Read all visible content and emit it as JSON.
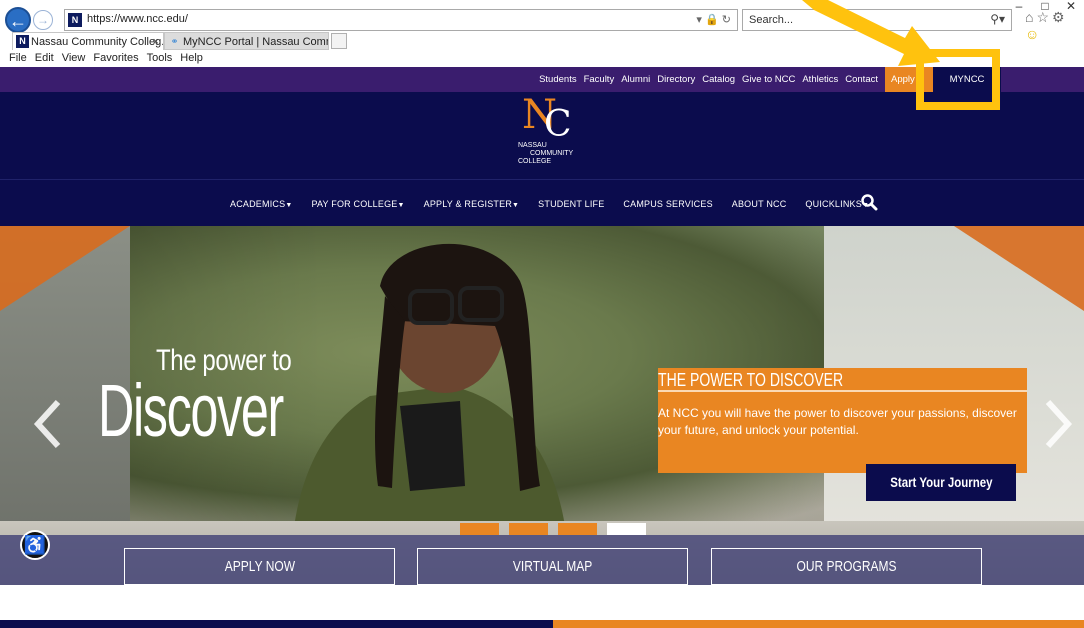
{
  "browser": {
    "url": "https://www.ncc.edu/",
    "url_host": "ncc.edu",
    "search_placeholder": "Search...",
    "tabs": [
      {
        "label": "Nassau Community Colleg...",
        "favicon": "ncc-favicon"
      },
      {
        "label": "MyNCC Portal | Nassau Comm...",
        "favicon": "ie-favicon"
      }
    ],
    "menu": [
      "File",
      "Edit",
      "View",
      "Favorites",
      "Tools",
      "Help"
    ],
    "window_controls": [
      "–",
      "□",
      "✕"
    ],
    "favicon_letter": "N"
  },
  "site": {
    "top_links": [
      "Students",
      "Faculty",
      "Alumni",
      "Directory",
      "Catalog",
      "Give to NCC",
      "Athletics",
      "Contact"
    ],
    "apply_label": "Apply N",
    "myncc_label": "MYNCC",
    "logo": {
      "letter_n": "N",
      "letter_c": "C",
      "line1": "NASSAU",
      "line2": "COMMUNITY",
      "line3": "COLLEGE"
    },
    "main_nav": [
      {
        "label": "ACADEMICS",
        "caret": true
      },
      {
        "label": "PAY FOR COLLEGE",
        "caret": true
      },
      {
        "label": "APPLY & REGISTER",
        "caret": true
      },
      {
        "label": "STUDENT LIFE",
        "caret": false
      },
      {
        "label": "CAMPUS SERVICES",
        "caret": false
      },
      {
        "label": "ABOUT NCC",
        "caret": false
      },
      {
        "label": "QUICKLINKS",
        "caret": true
      }
    ],
    "hero": {
      "small_text": "The power to",
      "big_text": "Discover",
      "promo_title": "THE POWER TO DISCOVER",
      "promo_body": "At NCC you will have the power to discover your passions, discover your future, and unlock your potential.",
      "cta_label": "Start Your Journey",
      "slides_total": 4,
      "active_slide": 4
    },
    "hero_buttons": [
      "APPLY NOW",
      "VIRTUAL MAP",
      "OUR PROGRAMS"
    ]
  },
  "colors": {
    "purple_bar": "#3a1d6e",
    "navy": "#0b0c4d",
    "orange": "#e98622",
    "highlight": "#ffc20e"
  }
}
